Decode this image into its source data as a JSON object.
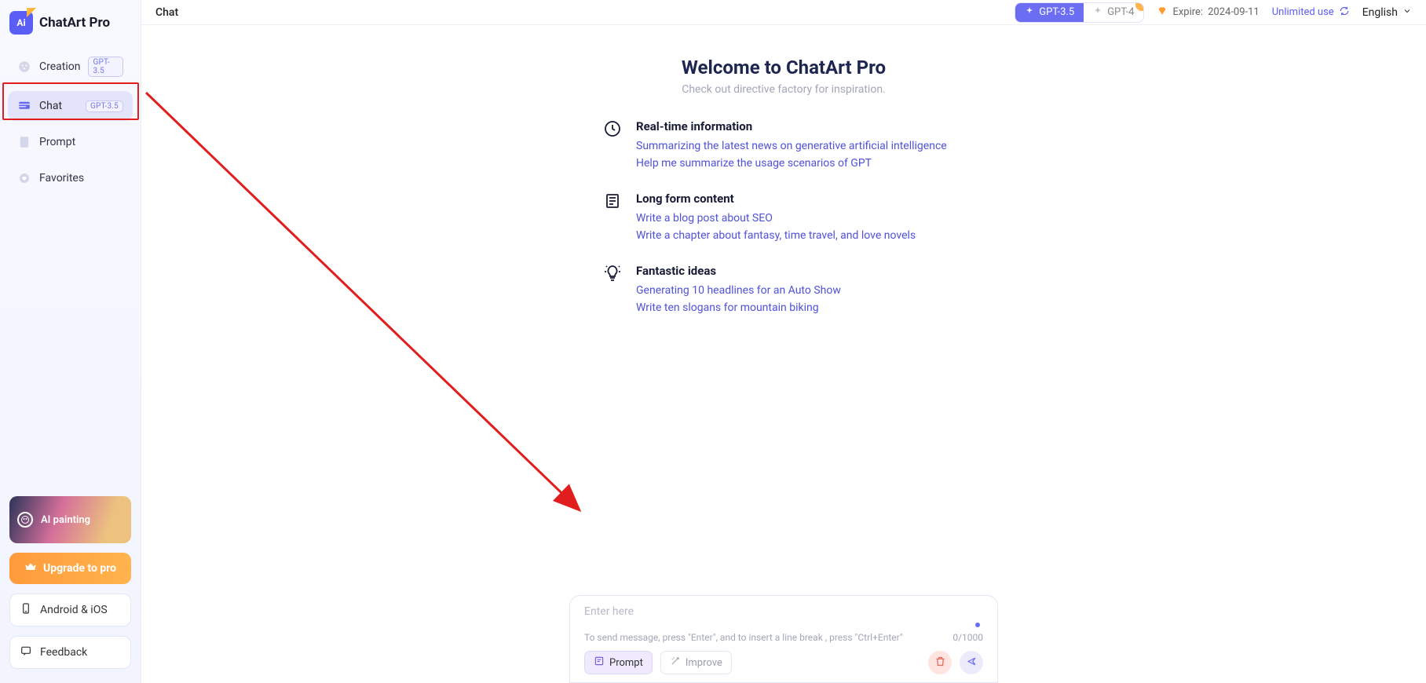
{
  "app": {
    "name": "ChatArt Pro",
    "logo_text": "Ai"
  },
  "sidebar": {
    "items": [
      {
        "label": "Creation",
        "badge": "GPT-3.5"
      },
      {
        "label": "Chat",
        "badge": "GPT-3.5"
      },
      {
        "label": "Prompt"
      },
      {
        "label": "Favorites"
      }
    ],
    "ai_painting_label": "AI painting",
    "upgrade_label": "Upgrade to pro",
    "android_ios_label": "Android & iOS",
    "feedback_label": "Feedback"
  },
  "header": {
    "title": "Chat",
    "model_active": "GPT-3.5",
    "model_inactive": "GPT-4",
    "expire_prefix": "Expire:",
    "expire_date": "2024-09-11",
    "unlimited_label": "Unlimited use",
    "language": "English"
  },
  "welcome": {
    "title": "Welcome to ChatArt Pro",
    "subtitle": "Check out directive factory for inspiration."
  },
  "sections": [
    {
      "title": "Real-time information",
      "links": [
        "Summarizing the latest news on generative artificial intelligence",
        "Help me summarize the usage scenarios of GPT"
      ]
    },
    {
      "title": "Long form content",
      "links": [
        "Write a blog post about SEO",
        "Write a chapter about fantasy, time travel, and love novels"
      ]
    },
    {
      "title": "Fantastic ideas",
      "links": [
        "Generating 10 headlines for an Auto Show",
        "Write ten slogans for mountain biking"
      ]
    }
  ],
  "input": {
    "placeholder": "Enter here",
    "hint": "To send message, press \"Enter\", and to insert a line break , press \"Ctrl+Enter\"",
    "counter": "0/1000",
    "prompt_label": "Prompt",
    "improve_label": "Improve"
  }
}
